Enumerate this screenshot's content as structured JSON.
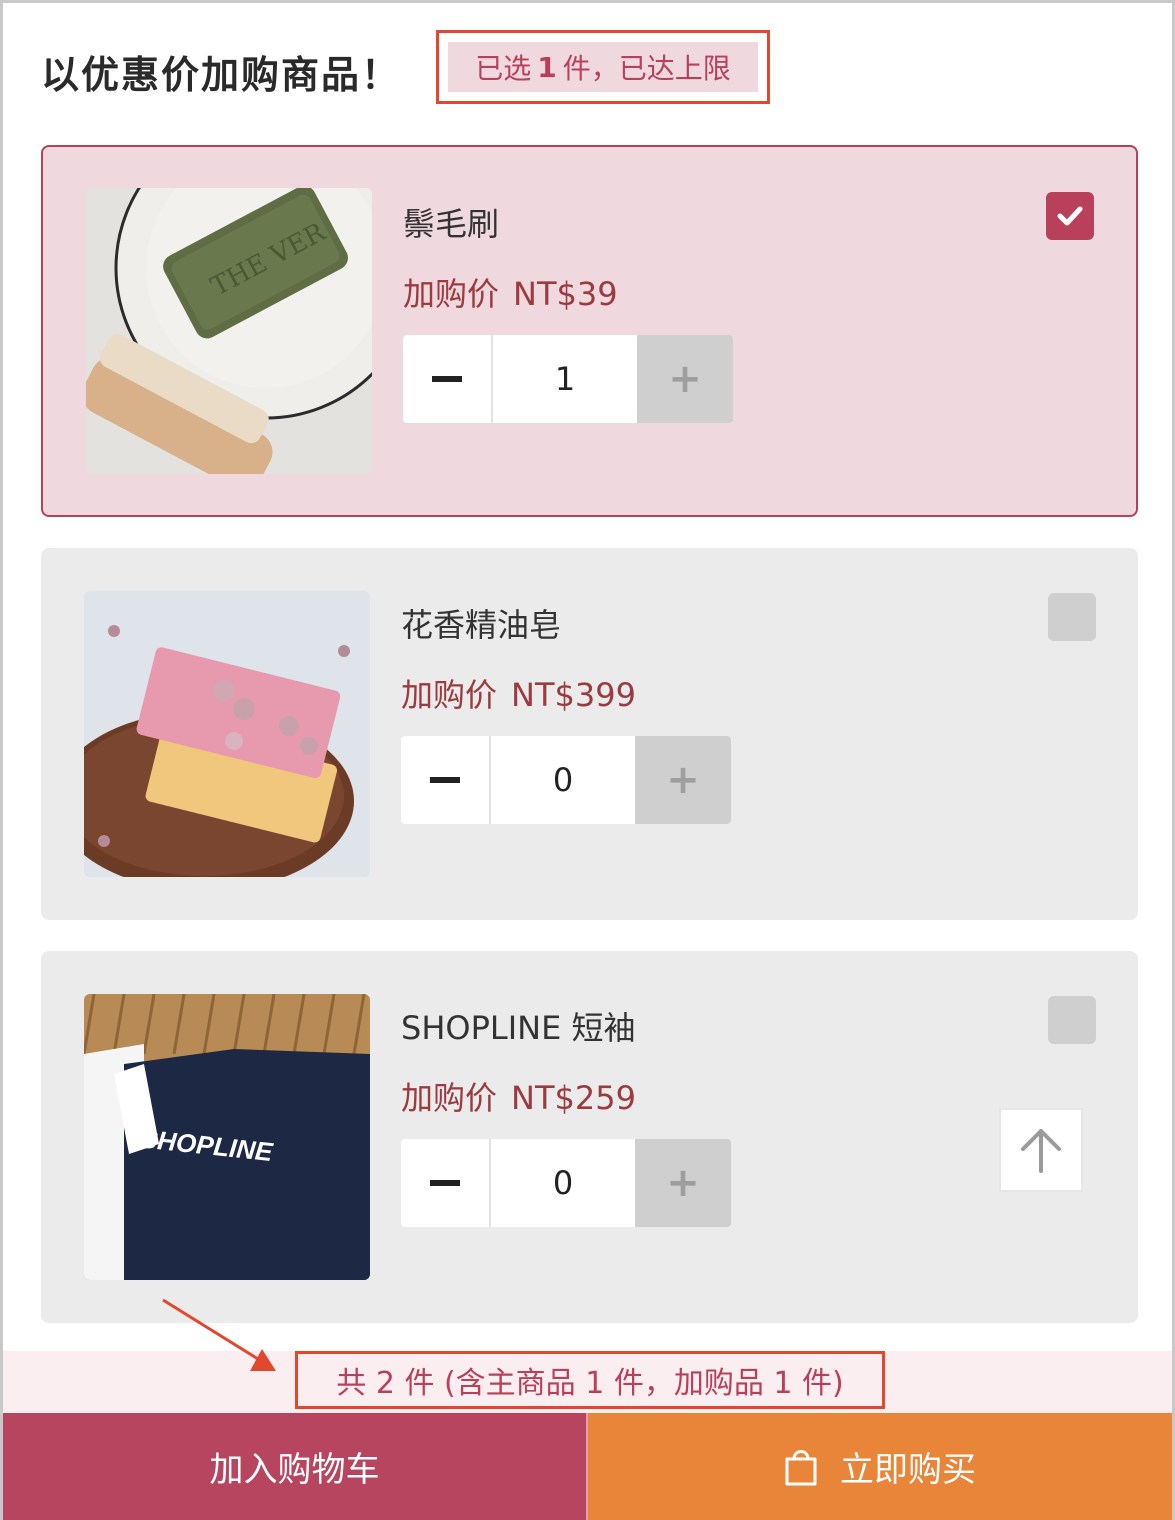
{
  "header": {
    "title": "以优惠价加购商品！",
    "limit_prefix": "已选",
    "limit_count": "1",
    "limit_suffix": "件，已达上限"
  },
  "products": [
    {
      "name": "鬃毛刷",
      "price_label": "加购价",
      "price": "NT$39",
      "quantity": "1",
      "checked": true,
      "image": "soap-and-brush-photo"
    },
    {
      "name": "花香精油皂",
      "price_label": "加购价",
      "price": "NT$399",
      "quantity": "0",
      "checked": false,
      "image": "rose-soap-photo"
    },
    {
      "name": "SHOPLINE 短袖",
      "price_label": "加购价",
      "price": "NT$259",
      "quantity": "0",
      "checked": false,
      "image": "tshirt-photo",
      "image_text": "SHOPLINE"
    }
  ],
  "stepper": {
    "minus": "−",
    "plus": "+"
  },
  "summary": "共 2 件 (含主商品 1 件，加购品 1 件)",
  "footer": {
    "add_to_cart": "加入购物车",
    "buy_now": "立即购买"
  },
  "colors": {
    "accent": "#b8405a",
    "buy": "#e88538",
    "price": "#9b3a3f",
    "annotation": "#e0492e"
  },
  "icons": {
    "checkbox": "check-icon",
    "back_to_top": "arrow-up-icon",
    "bag": "shopping-bag-icon"
  }
}
